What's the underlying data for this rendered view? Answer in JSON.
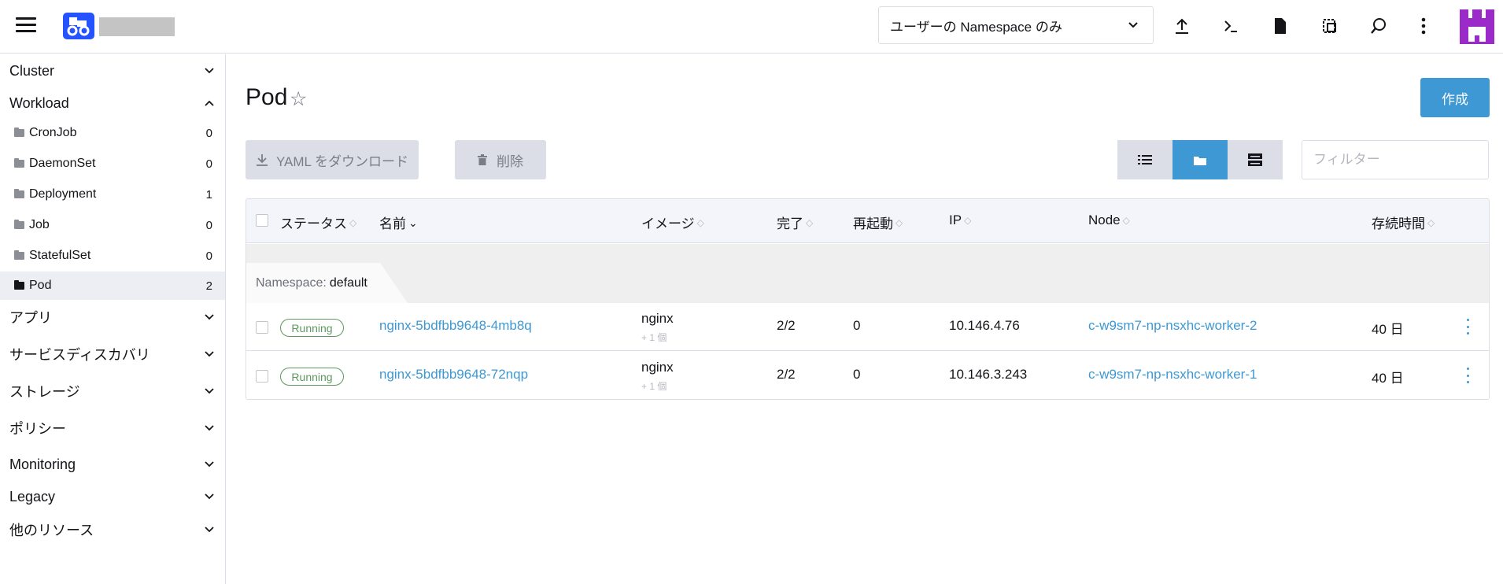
{
  "header": {
    "namespace_filter": "ユーザーの Namespace のみ",
    "icons": [
      "upload-icon",
      "terminal-icon",
      "file-icon",
      "copy-icon",
      "search-icon",
      "more-icon"
    ]
  },
  "sidebar": {
    "groups": [
      {
        "label": "Cluster"
      },
      {
        "label": "Workload"
      },
      {
        "label": "アプリ"
      },
      {
        "label": "サービスディスカバリ"
      },
      {
        "label": "ストレージ"
      },
      {
        "label": "ポリシー"
      },
      {
        "label": "Monitoring"
      },
      {
        "label": "Legacy"
      },
      {
        "label": "他のリソース"
      }
    ],
    "workload_items": [
      {
        "label": "CronJob",
        "count": "0"
      },
      {
        "label": "DaemonSet",
        "count": "0"
      },
      {
        "label": "Deployment",
        "count": "1"
      },
      {
        "label": "Job",
        "count": "0"
      },
      {
        "label": "StatefulSet",
        "count": "0"
      },
      {
        "label": "Pod",
        "count": "2"
      }
    ]
  },
  "main": {
    "title": "Pod",
    "create_label": "作成",
    "download_label": "YAML をダウンロード",
    "delete_label": "削除",
    "filter_placeholder": "フィルター"
  },
  "table": {
    "columns": {
      "status": "ステータス",
      "name": "名前",
      "image": "イメージ",
      "ready": "完了",
      "restarts": "再起動",
      "ip": "IP",
      "node": "Node",
      "age": "存続時間"
    },
    "group_label": "Namespace:",
    "group_value": "default",
    "rows": [
      {
        "status": "Running",
        "name": "nginx-5bdfbb9648-4mb8q",
        "image": "nginx",
        "image_more": "+ 1 個",
        "ready": "2/2",
        "restarts": "0",
        "ip": "10.146.4.76",
        "node": "c-w9sm7-np-nsxhc-worker-2",
        "age": "40 日"
      },
      {
        "status": "Running",
        "name": "nginx-5bdfbb9648-72nqp",
        "image": "nginx",
        "image_more": "+ 1 個",
        "ready": "2/2",
        "restarts": "0",
        "ip": "10.146.3.243",
        "node": "c-w9sm7-np-nsxhc-worker-1",
        "age": "40 日"
      }
    ]
  },
  "colors": {
    "accent": "#3d98d3",
    "running": "#5d995d",
    "logo": "#2453ff",
    "avatar": "#9a2bc8"
  }
}
